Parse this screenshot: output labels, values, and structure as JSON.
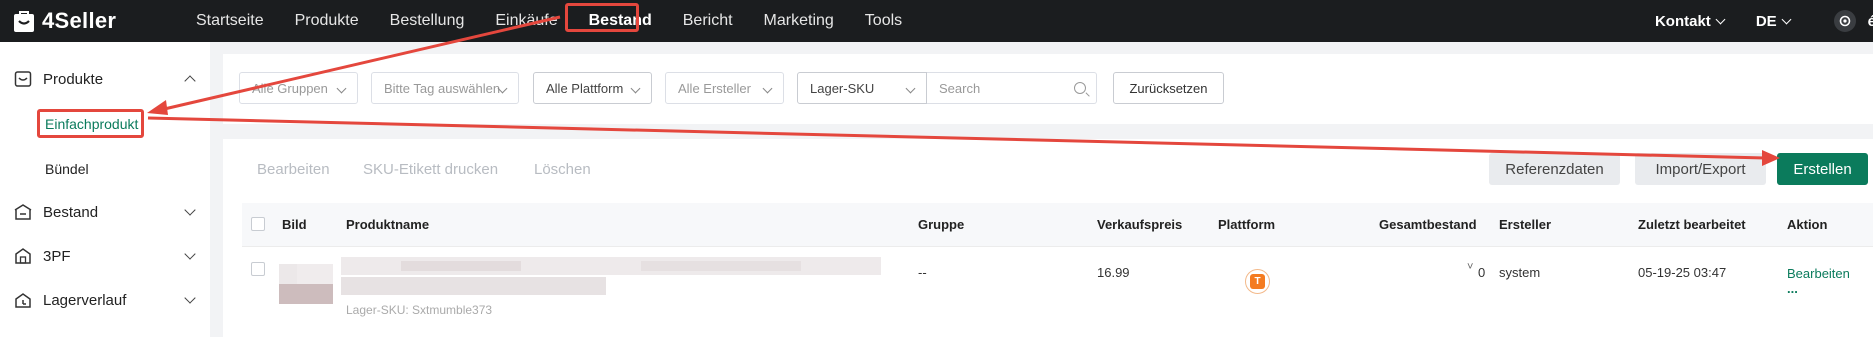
{
  "app": {
    "logo_text": "4Seller"
  },
  "nav": {
    "items": [
      "Startseite",
      "Produkte",
      "Bestellung",
      "Einkäufe",
      "Bestand",
      "Bericht",
      "Marketing",
      "Tools"
    ],
    "right": {
      "contact": "Kontakt",
      "language": "DE",
      "cut_text": "é"
    }
  },
  "sidebar": {
    "groups": [
      {
        "label": "Produkte",
        "icon": "product-box-icon"
      },
      {
        "label": "Bestand",
        "icon": "inventory-icon"
      },
      {
        "label": "3PF",
        "icon": "warehouse-icon"
      },
      {
        "label": "Lagerverlauf",
        "icon": "history-icon"
      }
    ],
    "sub_items": [
      "Einfachprodukt",
      "Bündel"
    ]
  },
  "filters": {
    "groups": "Alle Gruppen",
    "tag": "Bitte Tag auswählen",
    "platform": "Alle Plattform",
    "creator": "Alle Ersteller",
    "search_type": "Lager-SKU",
    "search_placeholder": "Search",
    "reset": "Zurücksetzen"
  },
  "toolbar": {
    "edit": "Bearbeiten",
    "print_label": "SKU-Etikett drucken",
    "delete": "Löschen",
    "reference": "Referenzdaten",
    "import_export": "Import/Export",
    "create": "Erstellen"
  },
  "table": {
    "columns": [
      "Bild",
      "Produktname",
      "Gruppe",
      "Verkaufspreis",
      "Plattform",
      "Gesamtbestand",
      "Ersteller",
      "Zuletzt bearbeitet",
      "Aktion"
    ],
    "rows": [
      {
        "sku_label": "Lager-SKU: Sxtmumble373",
        "group": "--",
        "price": "16.99",
        "platform_badge": "T",
        "stock": "0",
        "creator": "system",
        "edited": "05-19-25 03:47",
        "action": "Bearbeiten",
        "more": "..."
      }
    ]
  },
  "colors": {
    "accent": "#0b7b5c",
    "topbar": "#1b1d1f",
    "annotation": "#e4473d",
    "platform": "#f47b20"
  }
}
